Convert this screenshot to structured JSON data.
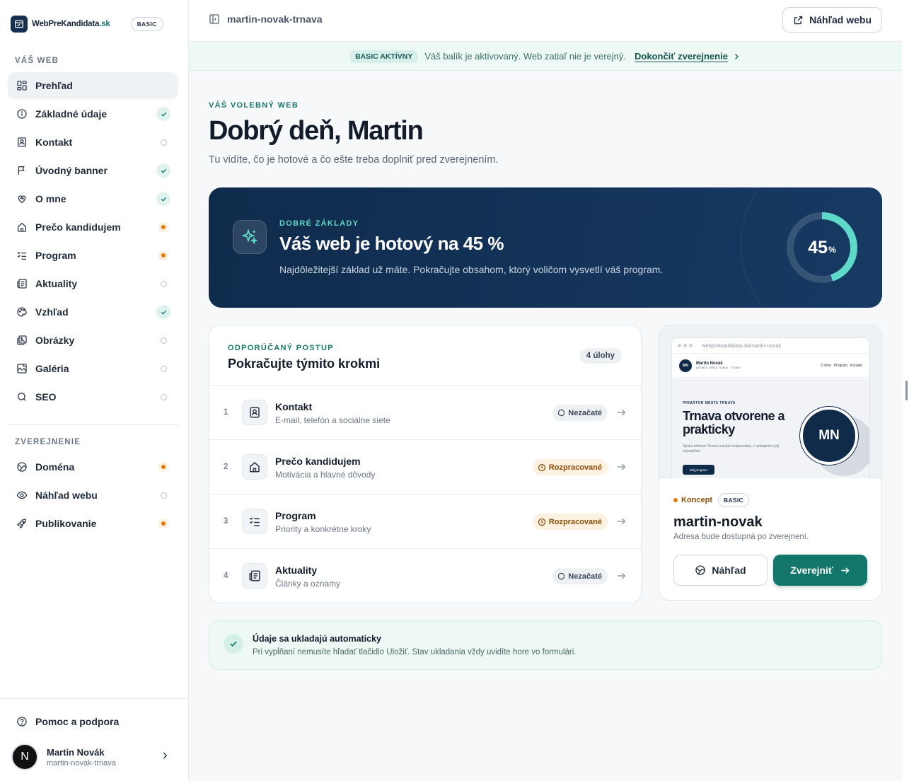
{
  "brand": {
    "name": "WebPreKandidata",
    "tld": ".sk",
    "badge": "BASIC"
  },
  "sidebar": {
    "section_web": "VÁŠ WEB",
    "section_publish": "ZVEREJNENIE",
    "items": [
      {
        "label": "Prehľad",
        "icon": "dashboard-icon",
        "status": "none"
      },
      {
        "label": "Základné údaje",
        "icon": "info-icon",
        "status": "done"
      },
      {
        "label": "Kontakt",
        "icon": "contact-card-icon",
        "status": "empty"
      },
      {
        "label": "Úvodný banner",
        "icon": "flag-icon",
        "status": "done"
      },
      {
        "label": "O mne",
        "icon": "heart-icon",
        "status": "done"
      },
      {
        "label": "Prečo kandidujem",
        "icon": "home-icon",
        "status": "progress"
      },
      {
        "label": "Program",
        "icon": "checklist-icon",
        "status": "progress"
      },
      {
        "label": "Aktuality",
        "icon": "newspaper-icon",
        "status": "empty"
      },
      {
        "label": "Vzhľad",
        "icon": "palette-icon",
        "status": "done"
      },
      {
        "label": "Obrázky",
        "icon": "images-icon",
        "status": "empty"
      },
      {
        "label": "Galéria",
        "icon": "gallery-icon",
        "status": "empty"
      },
      {
        "label": "SEO",
        "icon": "search-icon",
        "status": "empty"
      }
    ],
    "publish_items": [
      {
        "label": "Doména",
        "icon": "globe-icon",
        "status": "progress"
      },
      {
        "label": "Náhľad webu",
        "icon": "eye-icon",
        "status": "empty"
      },
      {
        "label": "Publikovanie",
        "icon": "rocket-icon",
        "status": "progress"
      }
    ],
    "help": "Pomoc a podpora",
    "user": {
      "initial": "N",
      "name": "Martin Novák",
      "slug": "martin-novak-trnava"
    }
  },
  "topbar": {
    "crumb": "martin-novak-trnava",
    "preview_label": "Náhľad webu"
  },
  "notice": {
    "tag": "BASIC AKTÍVNY",
    "text": "Váš balík je aktivovaný. Web zatiaľ nie je verejný.",
    "link": "Dokončiť zverejnenie"
  },
  "header": {
    "eyebrow": "VÁŠ VOLEBNÝ WEB",
    "greeting": "Dobrý deň, Martin",
    "subtitle": "Tu vidíte, čo je hotové a čo ešte treba doplniť pred zverejnením."
  },
  "hero": {
    "eyebrow": "DOBRÉ ZÁKLADY",
    "title": "Váš web je hotový na 45 %",
    "desc": "Najdôležitejší základ už máte. Pokračujte obsahom, ktorý voličom vysvetlí váš program.",
    "progress": 45,
    "progress_value": "45",
    "progress_unit": "%"
  },
  "steps": {
    "eyebrow": "ODPORÚČANÝ POSTUP",
    "title": "Pokračujte týmito krokmi",
    "count": "4 úlohy",
    "items": [
      {
        "num": "1",
        "name": "Kontakt",
        "desc": "E-mail, telefón a sociálne siete",
        "status": "Nezačaté",
        "kind": "new",
        "icon": "contact-card-icon"
      },
      {
        "num": "2",
        "name": "Prečo kandidujem",
        "desc": "Motivácia a hlavné dôvody",
        "status": "Rozpracované",
        "kind": "wip",
        "icon": "home-icon"
      },
      {
        "num": "3",
        "name": "Program",
        "desc": "Priority a konkrétne kroky",
        "status": "Rozpracované",
        "kind": "wip",
        "icon": "checklist-icon"
      },
      {
        "num": "4",
        "name": "Aktuality",
        "desc": "Články a oznamy",
        "status": "Nezačaté",
        "kind": "new",
        "icon": "newspaper-icon"
      }
    ]
  },
  "preview": {
    "mini": {
      "url": "webprekandidata.sk/martin-novak",
      "initials_small": "MN",
      "name": "Martin Novák",
      "role": "primátor mesta Trnava · Trnava",
      "nav": [
        "O mne",
        "Program",
        "Kontakt"
      ],
      "eyebrow": "PRIMÁTOR MESTA TRNAVA",
      "title": "Trnava otvorene a prakticky",
      "desc": "Spolu môžeme Trnavu rozvíjať zodpovedne, v spolupráci s jej obyvateľmi.",
      "button": "Môj program",
      "initials": "MN"
    },
    "status": "Koncept",
    "badge": "BASIC",
    "slug": "martin-novak",
    "note": "Adresa bude dostupná po zverejnení.",
    "btn_preview": "Náhľad",
    "btn_publish": "Zverejniť"
  },
  "autosave": {
    "title": "Údaje sa ukladajú automaticky",
    "desc": "Pri vypĺňaní nemusíte hľadať tlačidlo Uložiť. Stav ukladania vždy uvidíte hore vo formulári."
  },
  "colors": {
    "accent": "#13766a",
    "navy": "#0f2b4c",
    "progress": "#e07b0b",
    "ring": "#5fdac8"
  }
}
